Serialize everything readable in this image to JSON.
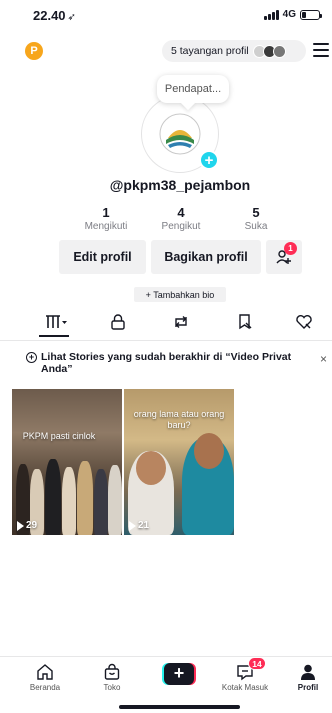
{
  "status_bar": {
    "time": "22.40",
    "location_arrow": "location-arrow-icon",
    "network": "4G",
    "battery_level": 0.25
  },
  "header": {
    "coin_badge": "P",
    "views_pill": "5 tayangan profil",
    "menu_icon": "hamburger-menu-icon"
  },
  "profile": {
    "note": "Pendapat...",
    "username": "@pkpm38_pejambon",
    "stats": [
      {
        "value": "1",
        "label": "Mengikuti"
      },
      {
        "value": "4",
        "label": "Pengikut"
      },
      {
        "value": "5",
        "label": "Suka"
      }
    ],
    "edit_label": "Edit profil",
    "share_label": "Bagikan profil",
    "add_friends_badge": "1",
    "bio_label": "+ Tambahkan bio"
  },
  "tabs": [
    {
      "icon": "grid-icon",
      "active": true
    },
    {
      "icon": "lock-icon",
      "active": false
    },
    {
      "icon": "repost-icon",
      "active": false
    },
    {
      "icon": "bookmark-icon",
      "active": false
    },
    {
      "icon": "heart-icon",
      "active": false
    }
  ],
  "notice": {
    "text": "Lihat Stories yang sudah berakhir di “Video Privat Anda”",
    "close": "×"
  },
  "videos": [
    {
      "caption": "PKPM pasti cinlok",
      "views": "29"
    },
    {
      "caption": "orang lama atau orang baru?",
      "views": "21"
    }
  ],
  "bottom_nav": {
    "items": [
      {
        "label": "Beranda",
        "icon": "home-icon"
      },
      {
        "label": "Toko",
        "icon": "shop-bag-icon"
      },
      {
        "label": "Kotak Masuk",
        "icon": "inbox-icon"
      },
      {
        "label": "Profil",
        "icon": "profile-icon"
      }
    ],
    "create_label": "+",
    "inbox_badge": "14"
  },
  "colors": {
    "accent_red": "#fe2c55",
    "accent_cyan": "#20d5ec",
    "coin": "#f7a61c"
  }
}
